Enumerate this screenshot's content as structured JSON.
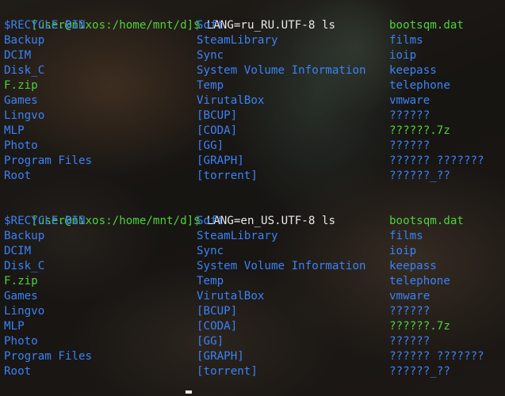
{
  "colors": {
    "prompt": "#4fd13c",
    "command": "#e8e8e8",
    "directory": "#3b82f6",
    "executable": "#4fd13c",
    "other": "#d6cf3a"
  },
  "sessions": [
    {
      "prompt": "[user@nixos:/home/mnt/d]$",
      "command": "LANG=ru_RU.UTF-8 ls",
      "rows": [
        [
          {
            "t": "$RECYCLE.BIN",
            "k": "directory"
          },
          {
            "t": "Soft",
            "k": "directory"
          },
          {
            "t": "bootsqm.dat",
            "k": "executable"
          }
        ],
        [
          {
            "t": "Backup",
            "k": "directory"
          },
          {
            "t": "SteamLibrary",
            "k": "directory"
          },
          {
            "t": "films",
            "k": "directory"
          }
        ],
        [
          {
            "t": "DCIM",
            "k": "directory"
          },
          {
            "t": "Sync",
            "k": "directory"
          },
          {
            "t": "ioip",
            "k": "directory"
          }
        ],
        [
          {
            "t": "Disk_C",
            "k": "directory"
          },
          {
            "t": "System Volume Information",
            "k": "directory"
          },
          {
            "t": "keepass",
            "k": "directory"
          }
        ],
        [
          {
            "t": "F.zip",
            "k": "executable"
          },
          {
            "t": "Temp",
            "k": "directory"
          },
          {
            "t": "telephone",
            "k": "directory"
          }
        ],
        [
          {
            "t": "Games",
            "k": "directory"
          },
          {
            "t": "VirutalBox",
            "k": "directory"
          },
          {
            "t": "vmware",
            "k": "directory"
          }
        ],
        [
          {
            "t": "Lingvo",
            "k": "directory"
          },
          {
            "t": "[BCUP]",
            "k": "directory"
          },
          {
            "t": "??????",
            "k": "directory"
          }
        ],
        [
          {
            "t": "MLP",
            "k": "directory"
          },
          {
            "t": "[CODA]",
            "k": "directory"
          },
          {
            "t": "??????.7z",
            "k": "executable"
          }
        ],
        [
          {
            "t": "Photo",
            "k": "directory"
          },
          {
            "t": "[GG]",
            "k": "directory"
          },
          {
            "t": "??????",
            "k": "directory"
          }
        ],
        [
          {
            "t": "Program Files",
            "k": "directory"
          },
          {
            "t": "[GRAPH]",
            "k": "directory"
          },
          {
            "t": "?????? ???????",
            "k": "directory"
          }
        ],
        [
          {
            "t": "Root",
            "k": "directory"
          },
          {
            "t": "[torrent]",
            "k": "directory"
          },
          {
            "t": "??????_??",
            "k": "directory"
          }
        ]
      ]
    },
    {
      "prompt": "[user@nixos:/home/mnt/d]$",
      "command": "LANG=en_US.UTF-8 ls",
      "rows": [
        [
          {
            "t": "$RECYCLE.BIN",
            "k": "directory"
          },
          {
            "t": "Soft",
            "k": "directory"
          },
          {
            "t": "bootsqm.dat",
            "k": "executable"
          }
        ],
        [
          {
            "t": "Backup",
            "k": "directory"
          },
          {
            "t": "SteamLibrary",
            "k": "directory"
          },
          {
            "t": "films",
            "k": "directory"
          }
        ],
        [
          {
            "t": "DCIM",
            "k": "directory"
          },
          {
            "t": "Sync",
            "k": "directory"
          },
          {
            "t": "ioip",
            "k": "directory"
          }
        ],
        [
          {
            "t": "Disk_C",
            "k": "directory"
          },
          {
            "t": "System Volume Information",
            "k": "directory"
          },
          {
            "t": "keepass",
            "k": "directory"
          }
        ],
        [
          {
            "t": "F.zip",
            "k": "executable"
          },
          {
            "t": "Temp",
            "k": "directory"
          },
          {
            "t": "telephone",
            "k": "directory"
          }
        ],
        [
          {
            "t": "Games",
            "k": "directory"
          },
          {
            "t": "VirutalBox",
            "k": "directory"
          },
          {
            "t": "vmware",
            "k": "directory"
          }
        ],
        [
          {
            "t": "Lingvo",
            "k": "directory"
          },
          {
            "t": "[BCUP]",
            "k": "directory"
          },
          {
            "t": "??????",
            "k": "directory"
          }
        ],
        [
          {
            "t": "MLP",
            "k": "directory"
          },
          {
            "t": "[CODA]",
            "k": "directory"
          },
          {
            "t": "??????.7z",
            "k": "executable"
          }
        ],
        [
          {
            "t": "Photo",
            "k": "directory"
          },
          {
            "t": "[GG]",
            "k": "directory"
          },
          {
            "t": "??????",
            "k": "directory"
          }
        ],
        [
          {
            "t": "Program Files",
            "k": "directory"
          },
          {
            "t": "[GRAPH]",
            "k": "directory"
          },
          {
            "t": "?????? ???????",
            "k": "directory"
          }
        ],
        [
          {
            "t": "Root",
            "k": "directory"
          },
          {
            "t": "[torrent]",
            "k": "directory"
          },
          {
            "t": "??????_??",
            "k": "directory"
          }
        ]
      ]
    }
  ]
}
